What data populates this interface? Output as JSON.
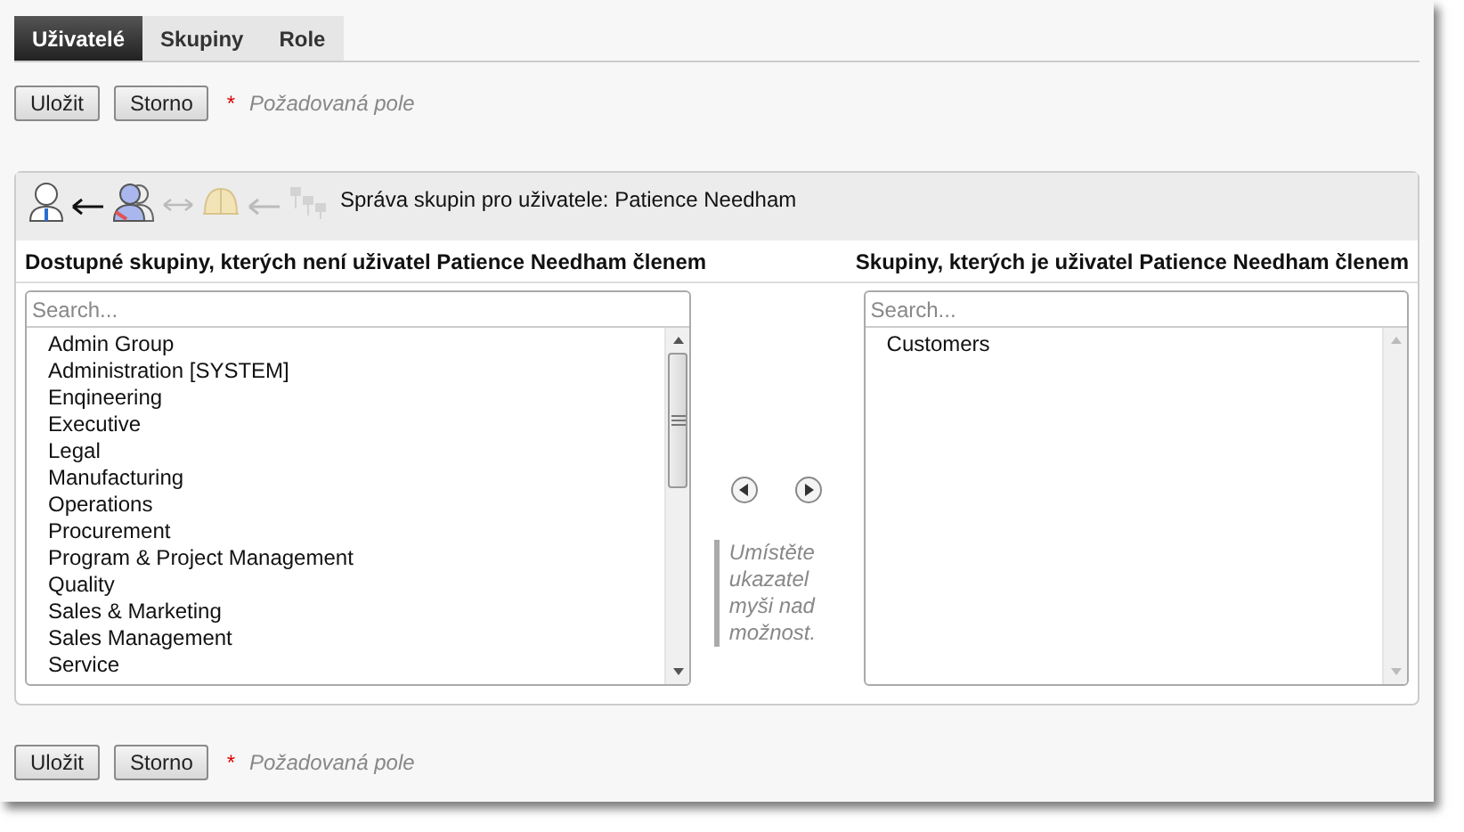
{
  "tabs": [
    {
      "label": "Uživatelé",
      "selected": true
    },
    {
      "label": "Skupiny",
      "selected": false
    },
    {
      "label": "Role",
      "selected": false
    }
  ],
  "top_actions": {
    "buttons": [
      "Uložit",
      "Storno"
    ],
    "required_mark": "*",
    "required_note": "Požadovaná pole"
  },
  "panel": {
    "title": "Správa skupin pro uživatele: Patience Needham",
    "available": {
      "heading": "Dostupné skupiny, kterých není uživatel Patience Needham členem",
      "search": {
        "placeholder": "Search..."
      },
      "items": [
        "Admin Group",
        "Administration [SYSTEM]",
        "Enqineering",
        "Executive",
        "Legal",
        "Manufacturing",
        "Operations",
        "Procurement",
        "Program & Project Management",
        "Quality",
        "Sales & Marketing",
        "Sales Management",
        "Service"
      ]
    },
    "hint": "Umístěte ukazatel myši nad možnost.",
    "member": {
      "heading": "Skupiny, kterých je uživatel Patience Needham členem",
      "search": {
        "placeholder": "Search..."
      },
      "items": [
        "Customers"
      ]
    }
  },
  "bottom_actions": {
    "buttons": [
      "Uložit",
      "Storno"
    ],
    "required_mark": "*",
    "required_note": "Požadovaná pole"
  }
}
